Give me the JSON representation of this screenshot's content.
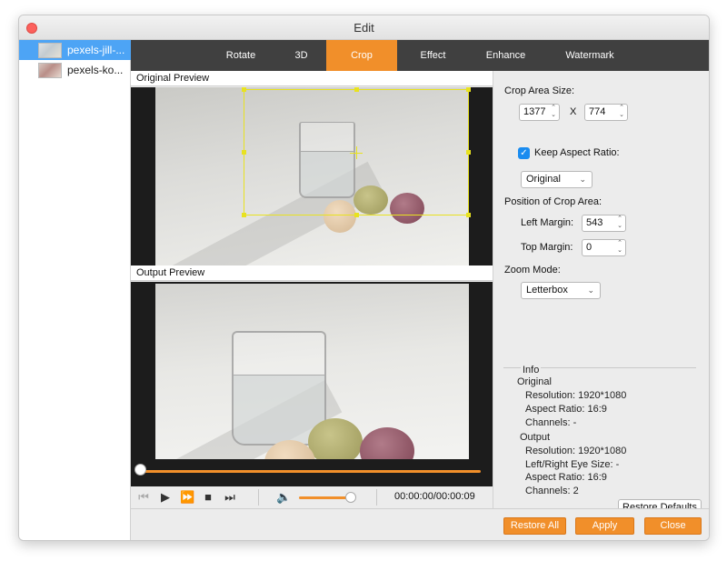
{
  "window": {
    "title": "Edit"
  },
  "sidebar": {
    "items": [
      {
        "label": "pexels-jill-...",
        "selected": true
      },
      {
        "label": "pexels-ko...",
        "selected": false
      }
    ]
  },
  "tabs": [
    {
      "label": "Rotate",
      "active": false
    },
    {
      "label": "3D",
      "active": false
    },
    {
      "label": "Crop",
      "active": true
    },
    {
      "label": "Effect",
      "active": false
    },
    {
      "label": "Enhance",
      "active": false
    },
    {
      "label": "Watermark",
      "active": false
    }
  ],
  "preview": {
    "original_label": "Original Preview",
    "output_label": "Output Preview"
  },
  "player": {
    "timecode": "00:00:00/00:00:09",
    "progress": 0,
    "volume": 0.9
  },
  "crop": {
    "area_size_label": "Crop Area Size:",
    "width": "1377",
    "x_label": "X",
    "height": "774",
    "keep_aspect_label": "Keep Aspect Ratio:",
    "keep_aspect_checked": true,
    "aspect_select": "Original",
    "position_label": "Position of Crop Area:",
    "left_margin_label": "Left Margin:",
    "left_margin": "543",
    "top_margin_label": "Top Margin:",
    "top_margin": "0",
    "zoom_mode_label": "Zoom Mode:",
    "zoom_mode": "Letterbox"
  },
  "info": {
    "title": "Info",
    "original_heading": "Original",
    "original_resolution": "Resolution: 1920*1080",
    "original_aspect": "Aspect Ratio: 16:9",
    "original_channels": "Channels: -",
    "output_heading": "Output",
    "output_resolution": "Resolution: 1920*1080",
    "output_eye_size": "Left/Right Eye Size: -",
    "output_aspect": "Aspect Ratio: 16:9",
    "output_channels": "Channels: 2"
  },
  "buttons": {
    "restore_defaults": "Restore Defaults",
    "restore_all": "Restore All",
    "apply": "Apply",
    "close": "Close"
  },
  "colors": {
    "accent": "#f18f2a",
    "tabbar": "#404040",
    "selection": "#4da4f5",
    "crop_frame": "#e8e220"
  },
  "icons": {
    "window_close": "close-dot-icon",
    "skip_start": "skip-start-icon",
    "play": "play-icon",
    "fast_forward": "fast-forward-icon",
    "stop": "stop-icon",
    "skip_end": "skip-end-icon",
    "volume": "volume-icon",
    "checkbox": "checkmark-icon"
  }
}
